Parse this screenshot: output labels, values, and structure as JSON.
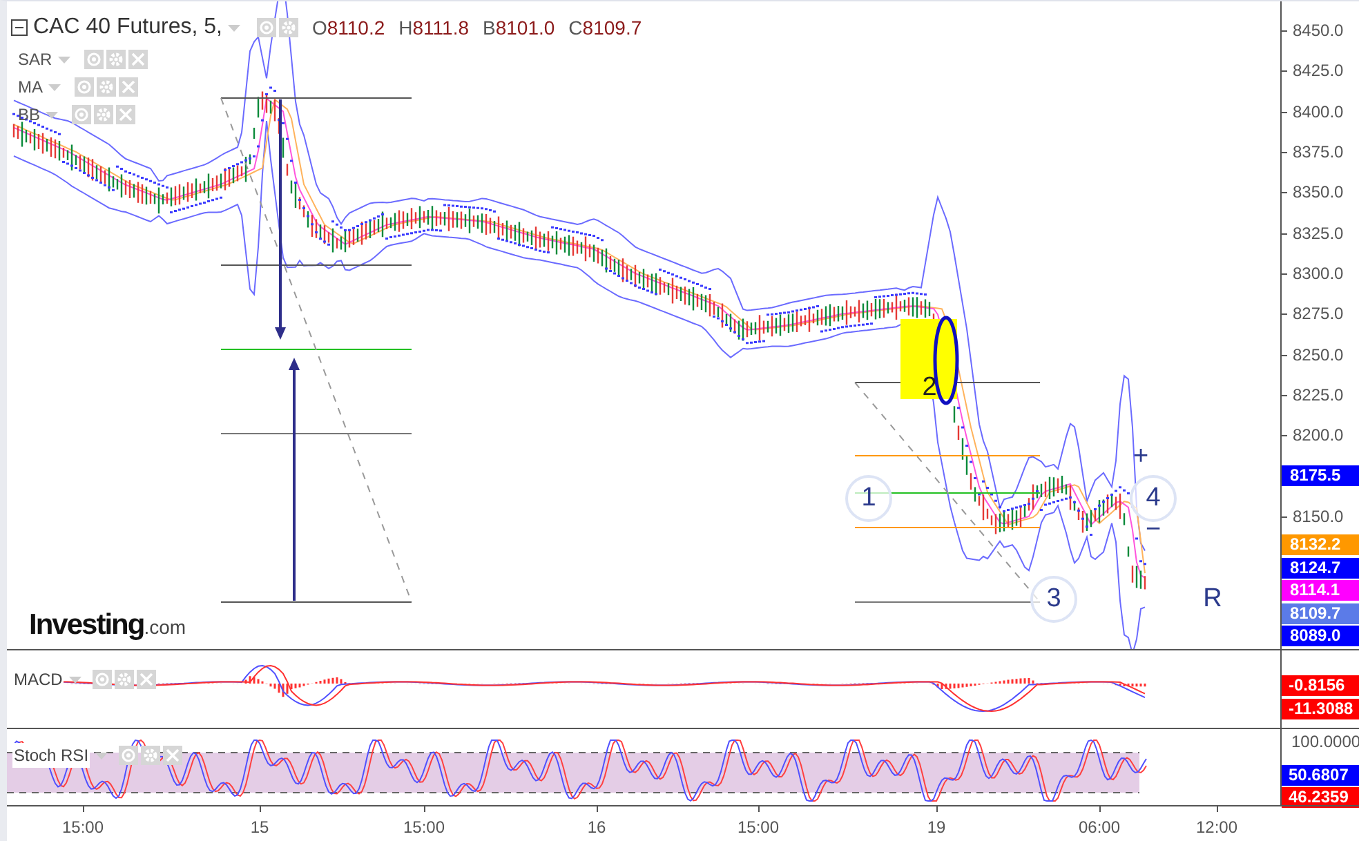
{
  "header": {
    "symbol": "CAC 40 Futures, 5,",
    "ohlc": [
      {
        "letter": "O",
        "value": "8110.2"
      },
      {
        "letter": "H",
        "value": "8111.8"
      },
      {
        "letter": "B",
        "value": "8101.0"
      },
      {
        "letter": "C",
        "value": "8109.7"
      }
    ]
  },
  "indicators": [
    {
      "name": "SAR"
    },
    {
      "name": "MA"
    },
    {
      "name": "BB"
    }
  ],
  "price_axis": {
    "ticks": [
      "8450.0",
      "8425.0",
      "8400.0",
      "8375.0",
      "8350.0",
      "8325.0",
      "8300.0",
      "8275.0",
      "8250.0",
      "8225.0",
      "8200.0",
      "8150.0"
    ],
    "markers": [
      {
        "value": "8175.5",
        "color": "#0000ff"
      },
      {
        "value": "8132.2",
        "color": "#ff9800"
      },
      {
        "value": "8124.7",
        "color": "#0000ff"
      },
      {
        "value": "8114.1",
        "color": "#ff00ff"
      },
      {
        "value": "8109.7",
        "color": "#5b7be8"
      },
      {
        "value": "8089.0",
        "color": "#0000ff"
      }
    ]
  },
  "annotations": [
    {
      "kind": "circle",
      "text": "1"
    },
    {
      "kind": "highlight",
      "text": "2"
    },
    {
      "kind": "circle",
      "text": "3"
    },
    {
      "kind": "circle",
      "text": "4"
    },
    {
      "kind": "plain",
      "text": "+"
    },
    {
      "kind": "plain",
      "text": "−"
    },
    {
      "kind": "plain",
      "text": "R"
    }
  ],
  "logo": {
    "name": "Investing",
    "suffix": ".com"
  },
  "macd": {
    "name": "MACD",
    "markers": [
      {
        "value": "-0.8156",
        "color": "#ff0000"
      },
      {
        "value": "-11.3088",
        "color": "#ff0000"
      }
    ]
  },
  "stoch_rsi": {
    "name": "Stoch RSI",
    "ticks": [
      "100.0000"
    ],
    "markers": [
      {
        "value": "50.6807",
        "color": "#0000ff"
      },
      {
        "value": "46.2359",
        "color": "#ff0000"
      }
    ]
  },
  "time_axis": [
    "15:00",
    "15",
    "15:00",
    "16",
    "15:00",
    "19",
    "06:00",
    "12:00"
  ]
}
